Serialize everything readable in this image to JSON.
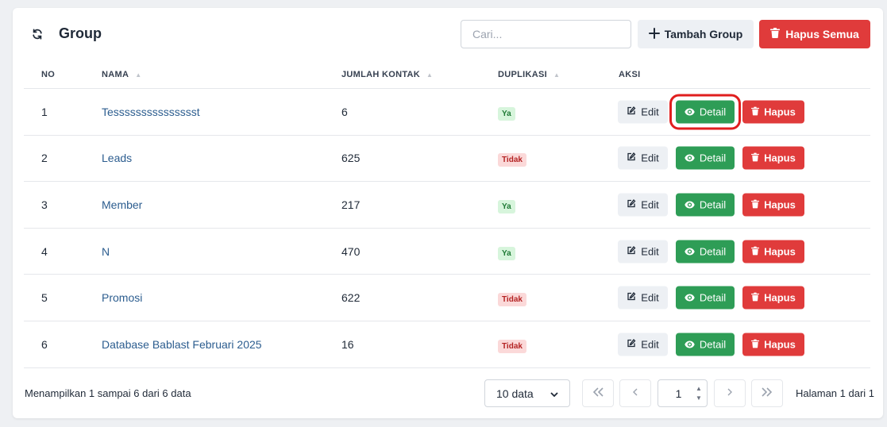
{
  "header": {
    "title": "Group",
    "search_placeholder": "Cari...",
    "add_label": "Tambah Group",
    "delete_all_label": "Hapus Semua"
  },
  "columns": {
    "no": "NO",
    "nama": "NAMA",
    "jumlah": "JUMLAH KONTAK",
    "duplikasi": "DUPLIKASI",
    "aksi": "AKSI"
  },
  "actions": {
    "edit": "Edit",
    "detail": "Detail",
    "hapus": "Hapus"
  },
  "rows": [
    {
      "no": "1",
      "nama": "Tessssssssssssssst",
      "jumlah": "6",
      "duplikasi": "Ya"
    },
    {
      "no": "2",
      "nama": "Leads",
      "jumlah": "625",
      "duplikasi": "Tidak"
    },
    {
      "no": "3",
      "nama": "Member",
      "jumlah": "217",
      "duplikasi": "Ya"
    },
    {
      "no": "4",
      "nama": "N",
      "jumlah": "470",
      "duplikasi": "Ya"
    },
    {
      "no": "5",
      "nama": "Promosi",
      "jumlah": "622",
      "duplikasi": "Tidak"
    },
    {
      "no": "6",
      "nama": "Database Bablast Februari 2025",
      "jumlah": "16",
      "duplikasi": "Tidak"
    }
  ],
  "footer": {
    "info": "Menampilkan 1 sampai 6 dari 6 data",
    "page_size": "10 data",
    "current_page": "1",
    "page_info": "Halaman 1 dari 1"
  },
  "colors": {
    "danger": "#e03b3b",
    "success": "#2e9d56",
    "link": "#2c5d8f",
    "highlight": "#e01e1e"
  }
}
